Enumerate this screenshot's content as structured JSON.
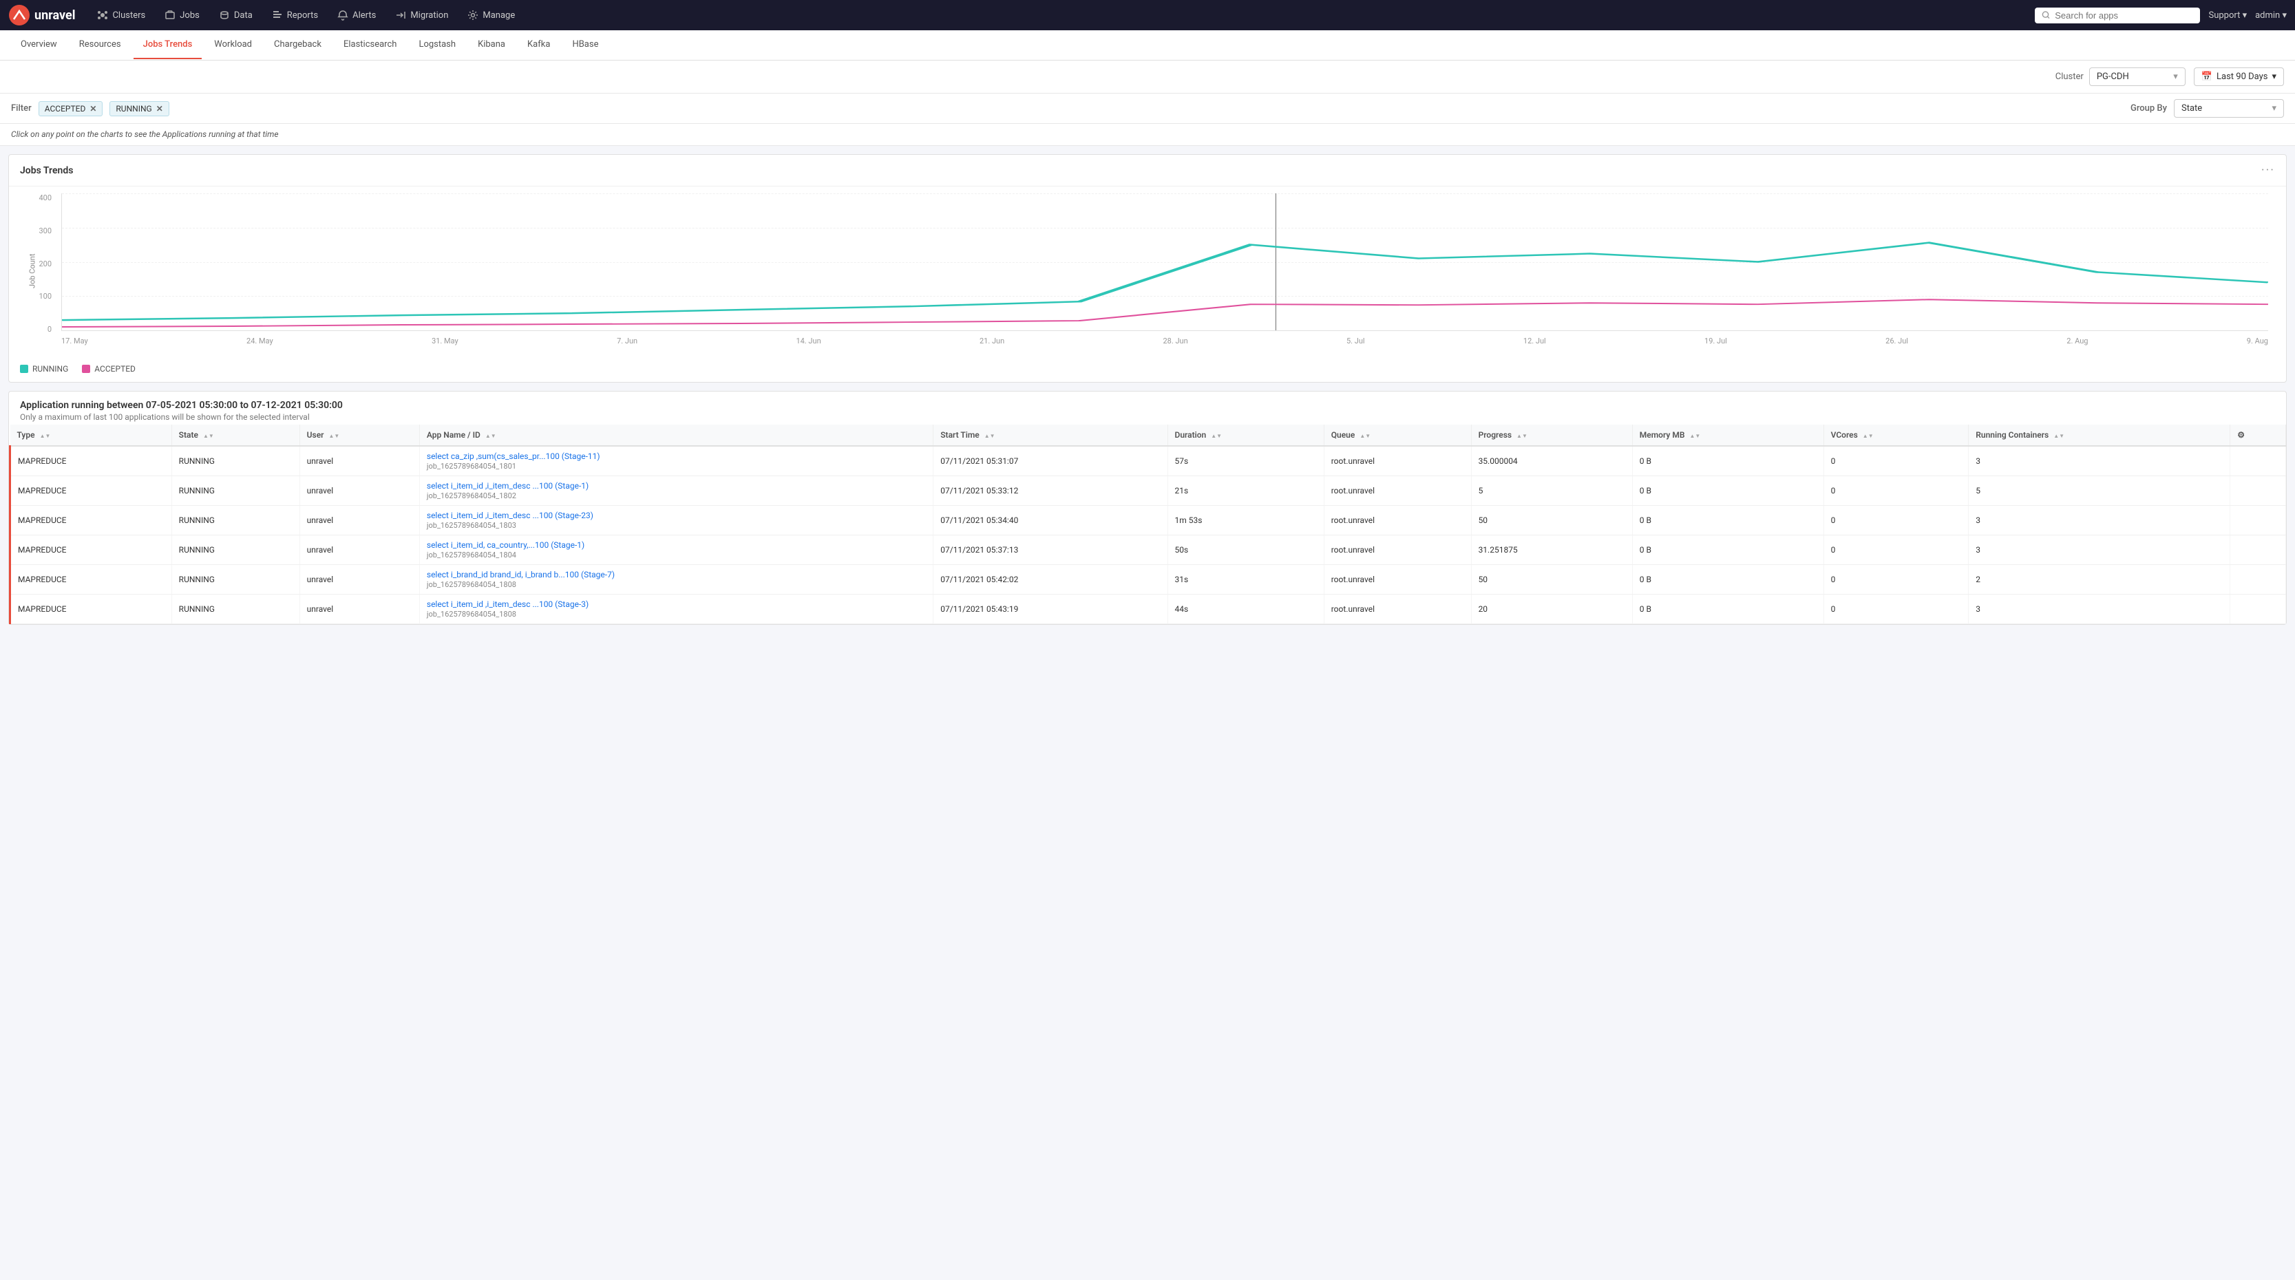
{
  "brand": {
    "name": "unravel"
  },
  "topNav": {
    "items": [
      {
        "label": "Clusters",
        "icon": "clusters-icon"
      },
      {
        "label": "Jobs",
        "icon": "jobs-icon"
      },
      {
        "label": "Data",
        "icon": "data-icon"
      },
      {
        "label": "Reports",
        "icon": "reports-icon"
      },
      {
        "label": "Alerts",
        "icon": "alerts-icon"
      },
      {
        "label": "Migration",
        "icon": "migration-icon"
      },
      {
        "label": "Manage",
        "icon": "manage-icon"
      }
    ],
    "search_placeholder": "Search for apps",
    "support_label": "Support ▾",
    "admin_label": "admin ▾"
  },
  "subNav": {
    "items": [
      {
        "label": "Overview"
      },
      {
        "label": "Resources"
      },
      {
        "label": "Jobs Trends",
        "active": true
      },
      {
        "label": "Workload"
      },
      {
        "label": "Chargeback"
      },
      {
        "label": "Elasticsearch"
      },
      {
        "label": "Logstash"
      },
      {
        "label": "Kibana"
      },
      {
        "label": "Kafka"
      },
      {
        "label": "HBase"
      }
    ]
  },
  "controls": {
    "cluster_label": "Cluster",
    "cluster_value": "PG-CDH",
    "date_range": "Last 90 Days"
  },
  "filter": {
    "label": "Filter",
    "tags": [
      "ACCEPTED",
      "RUNNING"
    ],
    "group_by_label": "Group By",
    "group_by_value": "State"
  },
  "info": {
    "text": "Click on any point on the charts to see the Applications running at that time"
  },
  "chart": {
    "title": "Jobs Trends",
    "menu": "···",
    "y_label": "Job Count",
    "y_ticks": [
      "400",
      "300",
      "200",
      "100",
      "0"
    ],
    "x_ticks": [
      "17. May",
      "24. May",
      "31. May",
      "7. Jun",
      "14. Jun",
      "21. Jun",
      "28. Jun",
      "5. Jul",
      "12. Jul",
      "19. Jul",
      "26. Jul",
      "2. Aug",
      "9. Aug"
    ],
    "legend": [
      {
        "label": "RUNNING",
        "color": "#2dc5b6"
      },
      {
        "label": "ACCEPTED",
        "color": "#e0509c"
      }
    ]
  },
  "application": {
    "title": "Application running between 07-05-2021 05:30:00 to 07-12-2021 05:30:00",
    "subtitle": "Only a maximum of last 100 applications will be shown for the selected interval",
    "table": {
      "columns": [
        "Type",
        "State",
        "User",
        "App Name / ID",
        "Start Time",
        "Duration",
        "Queue",
        "Progress",
        "Memory MB",
        "VCores",
        "Running Containers"
      ],
      "rows": [
        {
          "type": "MAPREDUCE",
          "state": "RUNNING",
          "user": "unravel",
          "app_name": "select ca_zip ,sum(cs_sales_pr...100 (Stage-11)",
          "app_id": "job_1625789684054_1801",
          "start_time": "07/11/2021 05:31:07",
          "duration": "57s",
          "queue": "root.unravel",
          "progress": "35.000004",
          "memory_mb": "0 B",
          "vcores": "0",
          "running_containers": "3"
        },
        {
          "type": "MAPREDUCE",
          "state": "RUNNING",
          "user": "unravel",
          "app_name": "select i_item_id ,i_item_desc ...100 (Stage-1)",
          "app_id": "job_1625789684054_1802",
          "start_time": "07/11/2021 05:33:12",
          "duration": "21s",
          "queue": "root.unravel",
          "progress": "5",
          "memory_mb": "0 B",
          "vcores": "0",
          "running_containers": "5"
        },
        {
          "type": "MAPREDUCE",
          "state": "RUNNING",
          "user": "unravel",
          "app_name": "select i_item_id ,i_item_desc ...100 (Stage-23)",
          "app_id": "job_1625789684054_1803",
          "start_time": "07/11/2021 05:34:40",
          "duration": "1m 53s",
          "queue": "root.unravel",
          "progress": "50",
          "memory_mb": "0 B",
          "vcores": "0",
          "running_containers": "3"
        },
        {
          "type": "MAPREDUCE",
          "state": "RUNNING",
          "user": "unravel",
          "app_name": "select i_item_id, ca_country,...100 (Stage-1)",
          "app_id": "job_1625789684054_1804",
          "start_time": "07/11/2021 05:37:13",
          "duration": "50s",
          "queue": "root.unravel",
          "progress": "31.251875",
          "memory_mb": "0 B",
          "vcores": "0",
          "running_containers": "3"
        },
        {
          "type": "MAPREDUCE",
          "state": "RUNNING",
          "user": "unravel",
          "app_name": "select i_brand_id brand_id, i_brand b...100 (Stage-7)",
          "app_id": "job_1625789684054_1808",
          "start_time": "07/11/2021 05:42:02",
          "duration": "31s",
          "queue": "root.unravel",
          "progress": "50",
          "memory_mb": "0 B",
          "vcores": "0",
          "running_containers": "2"
        },
        {
          "type": "MAPREDUCE",
          "state": "RUNNING",
          "user": "unravel",
          "app_name": "select i_item_id ,i_item_desc ...100 (Stage-3)",
          "app_id": "job_1625789684054_1808",
          "start_time": "07/11/2021 05:43:19",
          "duration": "44s",
          "queue": "root.unravel",
          "progress": "20",
          "memory_mb": "0 B",
          "vcores": "0",
          "running_containers": "3"
        }
      ]
    }
  }
}
